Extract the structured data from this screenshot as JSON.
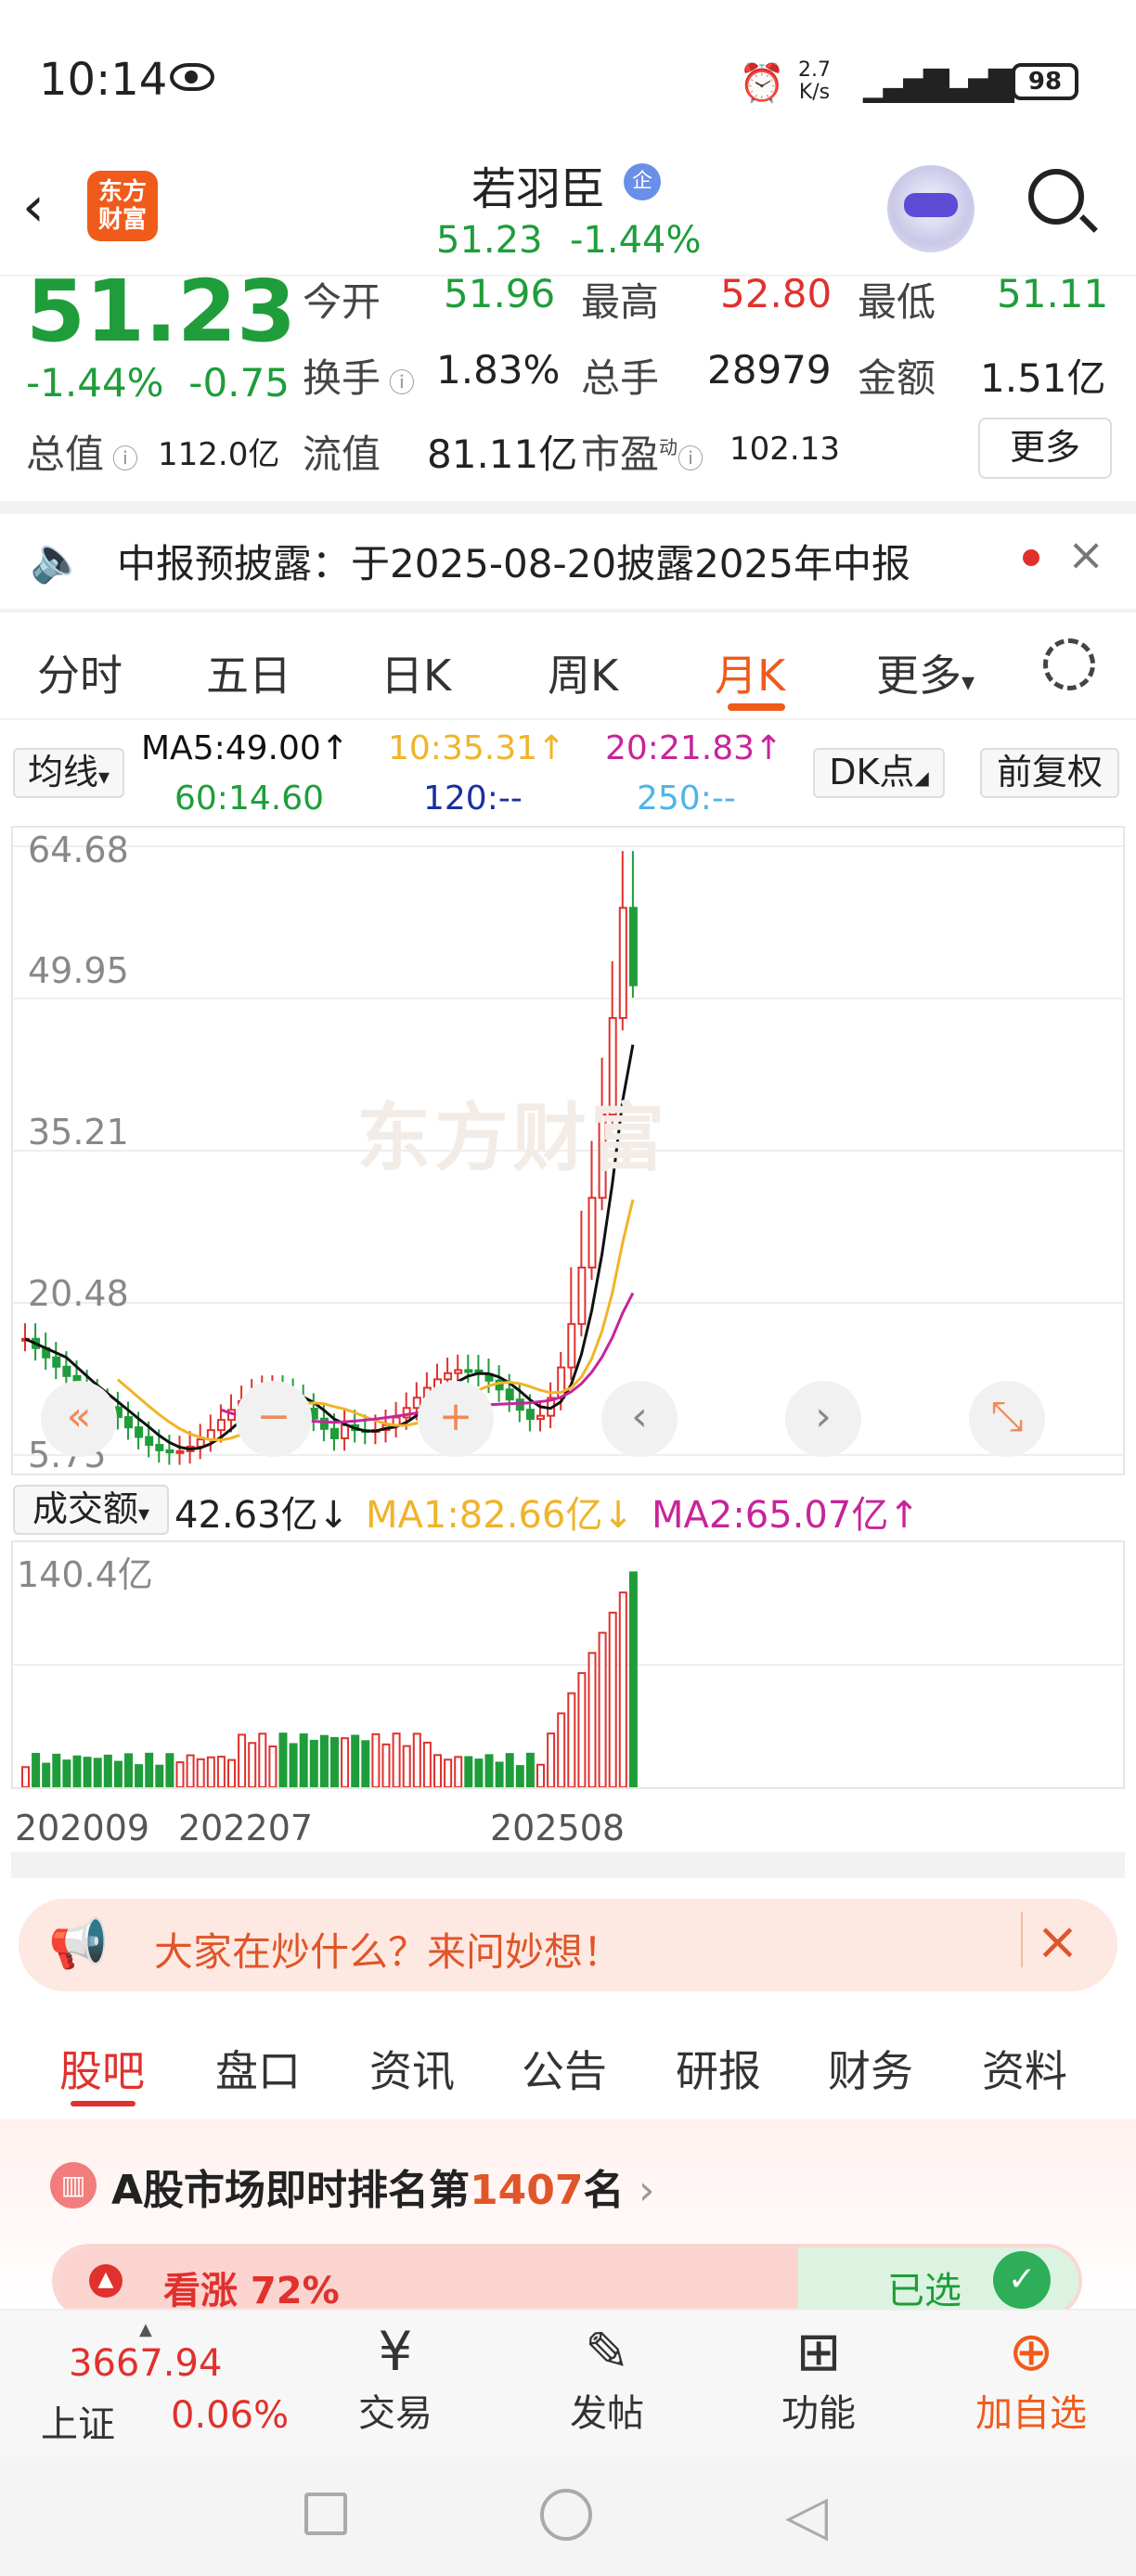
{
  "status_bar": {
    "time": "10:14",
    "net_speed": "2.7",
    "net_unit": "K/s",
    "battery": "98"
  },
  "header": {
    "app_logo": "东方\n财富",
    "stock_name": "若羽臣",
    "badge": "企",
    "price": "51.23",
    "change_pct": "-1.44%"
  },
  "quote": {
    "price": "51.23",
    "change_pct": "-1.44%",
    "change_amt": "-0.75",
    "open_label": "今开",
    "open": "51.96",
    "high_label": "最高",
    "high": "52.80",
    "low_label": "最低",
    "low": "51.11",
    "turnover_label": "换手",
    "turnover": "1.83%",
    "volume_label": "总手",
    "volume": "28979",
    "amount_label": "金额",
    "amount": "1.51亿",
    "mktcap_label": "总值",
    "mktcap": "112.0亿",
    "float_label": "流值",
    "float": "81.11亿",
    "pe_label": "市盈",
    "pe_sup": "动",
    "pe": "102.13",
    "more_button": "更多"
  },
  "notice": {
    "text": "中报预披露：于2025-08-20披露2025年中报",
    "close": "×"
  },
  "chart_tabs": [
    "分时",
    "五日",
    "日K",
    "周K",
    "月K",
    "更多"
  ],
  "chart_tab_more_arrow": "▾",
  "ma_row": {
    "ma_select": "均线",
    "ma5": "MA5:49.00↑",
    "ma10": "10:35.31↑",
    "ma20": "20:21.83↑",
    "ma60": "60:14.60",
    "ma120": "120:--",
    "ma250": "250:--",
    "dk_button": "DK点",
    "fq_button": "前复权"
  },
  "chart": {
    "watermark": "东方财富",
    "y_labels": [
      "64.68",
      "49.95",
      "35.21",
      "20.48",
      "5.75"
    ]
  },
  "volume_row": {
    "select": "成交额",
    "value": "42.63亿↓",
    "ma1": "MA1:82.66亿↓",
    "ma2": "MA2:65.07亿↑",
    "max_label": "140.4亿",
    "x_labels": [
      "202009",
      "202207",
      "202508"
    ]
  },
  "chart_data": {
    "type": "candlestick",
    "x_labels": [
      "202009",
      "202207",
      "202508"
    ],
    "ylim": [
      5.75,
      64.68
    ],
    "y_ticks": [
      64.68,
      49.95,
      35.21,
      20.48,
      5.75
    ],
    "last_close": 51.23,
    "period_high": 64.68,
    "ma": {
      "MA5": 49.0,
      "MA10": 35.31,
      "MA20": 21.83,
      "MA60": 14.6
    },
    "volume": {
      "unit": "亿",
      "max": 140.4,
      "last": 42.63,
      "MA1": 82.66,
      "MA2": 65.07
    }
  },
  "promo": {
    "text": "大家在炒什么？来问妙想！",
    "close": "×"
  },
  "bottom_tabs": [
    "股吧",
    "盘口",
    "资讯",
    "公告",
    "研报",
    "财务",
    "资料"
  ],
  "ranking": {
    "text_pre": "A股市场即时排名第",
    "rank": "1407",
    "text_post": "名",
    "arrow": "›"
  },
  "vote": {
    "up_label": "看涨 72%",
    "selected": "已选"
  },
  "bottom_nav": {
    "index_value": "3667.94",
    "index_name": "上证",
    "index_change": "0.06%",
    "trade": "交易",
    "post": "发帖",
    "func": "功能",
    "add": "加自选"
  },
  "colors": {
    "up": "#e0312d",
    "down": "#1f9d3a",
    "accent": "#f05a1a",
    "ma5": "#111111",
    "ma10": "#f0b429",
    "ma20": "#c8249a"
  }
}
